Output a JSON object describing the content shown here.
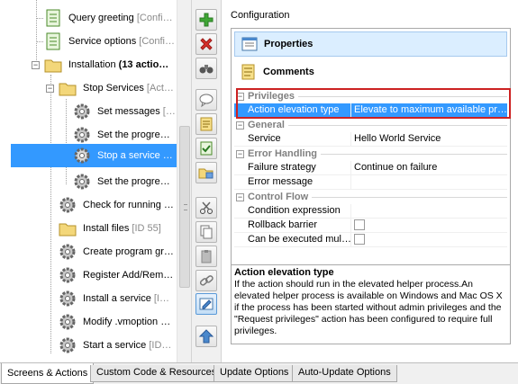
{
  "tree": {
    "items": [
      {
        "label": "Query greeting ",
        "sub": "[Confi…",
        "icon": "document-icon"
      },
      {
        "label": "Service options ",
        "sub": "[Confi…",
        "icon": "document-icon"
      },
      {
        "label": "Installation ",
        "bold_sub": "(13 actio…",
        "icon": "folder-icon"
      },
      {
        "label": "Stop Services ",
        "sub": "[Act…",
        "icon": "folder-icon"
      },
      {
        "label": "Set messages ",
        "sub": "[…",
        "icon": "gear-icon"
      },
      {
        "label": "Set the progre…",
        "sub": "",
        "icon": "gear-icon"
      },
      {
        "label": "Stop a service …",
        "sub": "",
        "icon": "gear-icon"
      },
      {
        "label": "Set the progre…",
        "sub": "",
        "icon": "gear-icon"
      },
      {
        "label": "Check for running …",
        "sub": "",
        "icon": "gear-icon"
      },
      {
        "label": "Install files ",
        "sub": "[ID 55]",
        "icon": "folder-icon"
      },
      {
        "label": "Create program gr…",
        "sub": "",
        "icon": "gear-icon"
      },
      {
        "label": "Register Add/Rem…",
        "sub": "",
        "icon": "gear-icon"
      },
      {
        "label": "Install a service ",
        "sub": "[I…",
        "icon": "gear-icon"
      },
      {
        "label": "Modify .vmoption …",
        "sub": "",
        "icon": "gear-icon"
      },
      {
        "label": "Start a service ",
        "sub": "[ID…",
        "icon": "gear-icon"
      }
    ]
  },
  "toolbar": {
    "buttons": [
      "add-icon",
      "delete-icon",
      "binoculars-icon",
      "speech-bubble-icon",
      "note-icon",
      "checklist-icon",
      "folder-open-icon",
      "cut-icon",
      "copy-icon",
      "paste-icon",
      "link-icon",
      "edit-icon",
      "arrow-up-icon"
    ]
  },
  "config": {
    "title": "Configuration",
    "tabs": {
      "properties": "Properties",
      "comments": "Comments"
    },
    "categories": {
      "privileges": "Privileges",
      "general": "General",
      "error_handling": "Error Handling",
      "control_flow": "Control Flow"
    },
    "rows": {
      "action_elevation_type": {
        "key": "Action elevation type",
        "value": "Elevate to maximum available pr…"
      },
      "service": {
        "key": "Service",
        "value": "Hello World Service"
      },
      "failure_strategy": {
        "key": "Failure strategy",
        "value": "Continue on failure"
      },
      "error_message": {
        "key": "Error message",
        "value": ""
      },
      "condition_expression": {
        "key": "Condition expression",
        "value": ""
      },
      "rollback_barrier": {
        "key": "Rollback barrier",
        "checked": false
      },
      "can_be_executed": {
        "key": "Can be executed mul…",
        "checked": false
      }
    },
    "description": {
      "title": "Action elevation type",
      "text": "If the action should run in the elevated helper process.An elevated helper process is available on Windows and Mac OS X if the process has been started without admin privileges and the \"Request privileges\" action has been configured to require full privileges."
    }
  },
  "bottom_tabs": [
    "Screens & Actions",
    "Custom Code & Resources",
    "Update Options",
    "Auto-Update Options"
  ],
  "colors": {
    "selection": "#3399ff",
    "highlight_border": "#cc2222",
    "active_tab": "#dbeeff"
  }
}
